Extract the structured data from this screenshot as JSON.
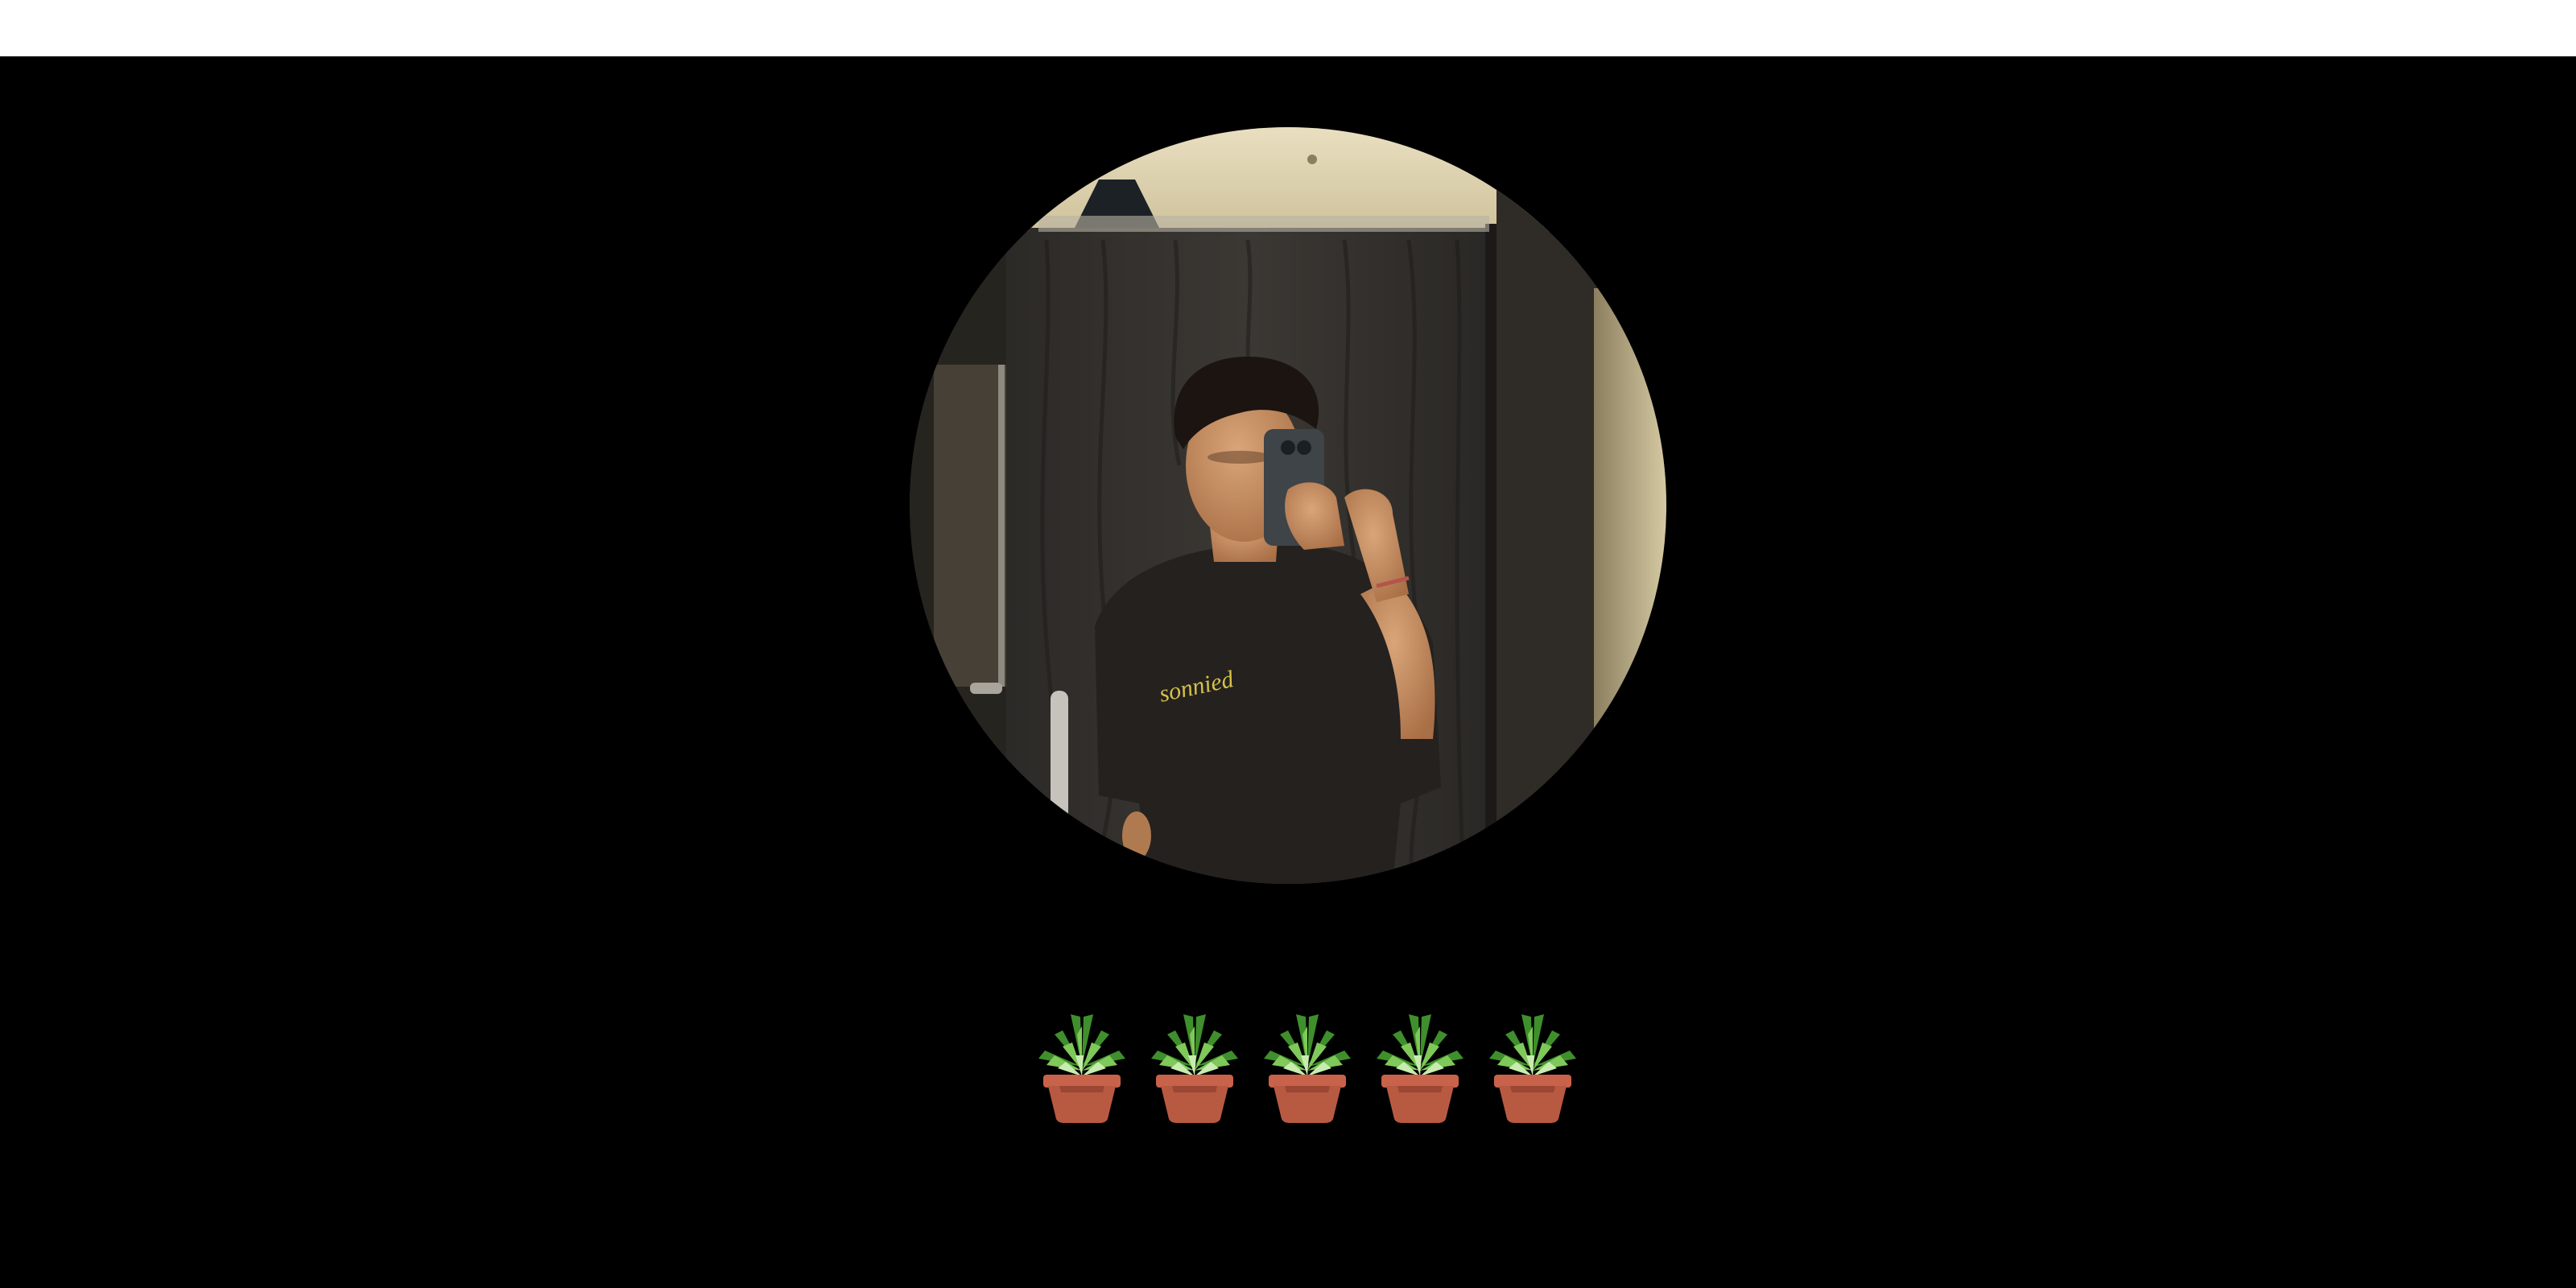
{
  "page": {
    "background_color": "#000000",
    "top_bar_color": "#ffffff"
  },
  "profile": {
    "photo": "mirror-selfie-portrait",
    "shirt_text": "sonnied"
  },
  "rating": {
    "icon": "potted-plant-icon",
    "count": 5,
    "max": 5
  }
}
